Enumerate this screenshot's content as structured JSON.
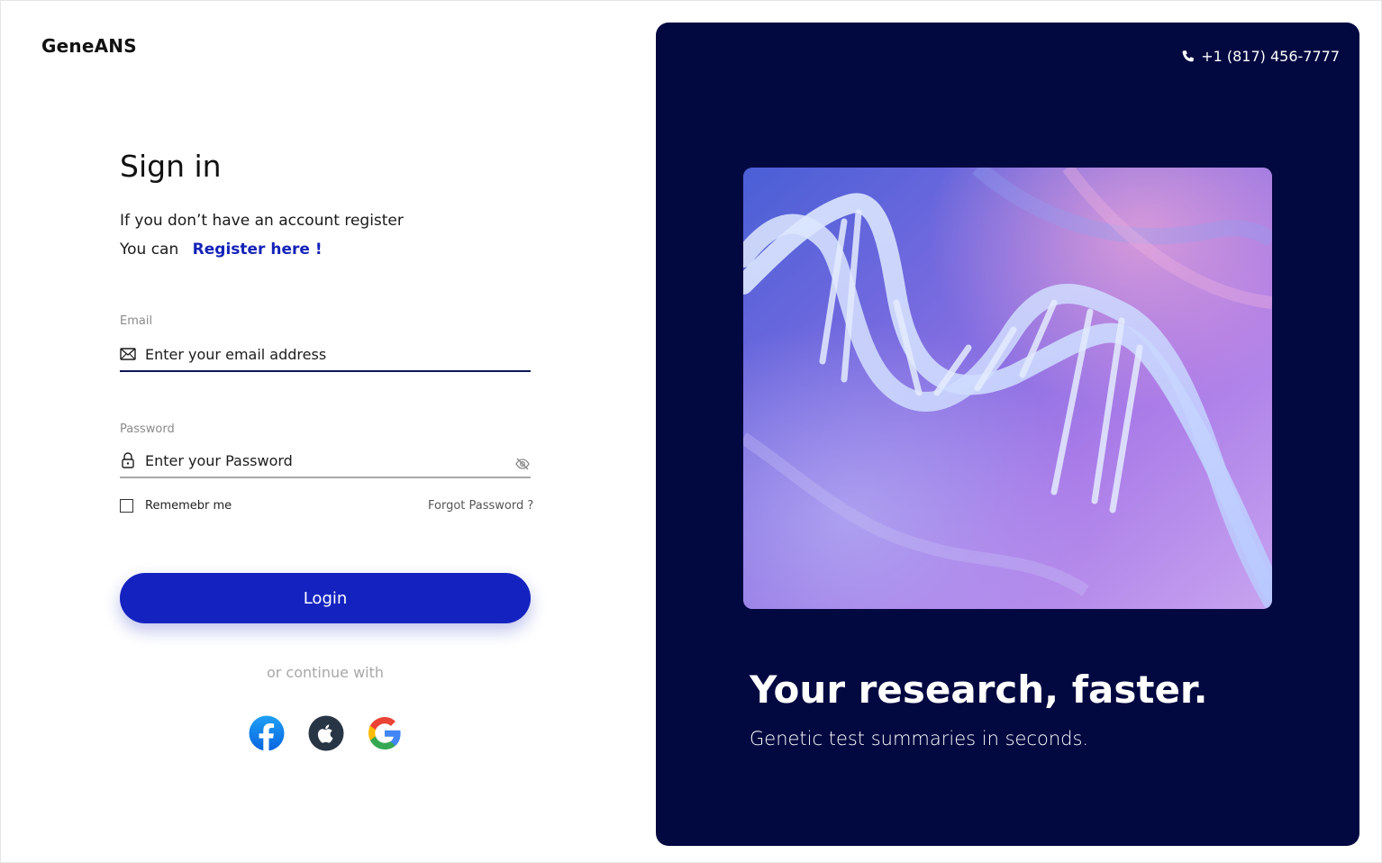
{
  "brand": {
    "name": "GeneANS"
  },
  "signin": {
    "title": "Sign in",
    "register_prompt": "If you don’t have an account register",
    "register_prefix": "You can",
    "register_link": "Register here !"
  },
  "email": {
    "label": "Email",
    "placeholder": "Enter your email address",
    "icon": "mail-icon"
  },
  "password": {
    "label": "Password",
    "placeholder": "Enter your Password",
    "icon": "lock-icon",
    "toggle_icon": "eye-off-icon"
  },
  "remember": {
    "label": "Rememebr me",
    "checked": false
  },
  "forgot": {
    "label": "Forgot Password ?"
  },
  "login": {
    "label": "Login"
  },
  "continue": {
    "label": "or continue with"
  },
  "social": [
    "facebook-icon",
    "apple-icon",
    "google-icon"
  ],
  "right": {
    "phone": "+1 (817) 456-7777",
    "phone_icon": "phone-icon",
    "headline": "Your research, faster.",
    "subheadline": "Genetic test summaries in seconds."
  },
  "colors": {
    "accent": "#1423c0",
    "panel": "#020840",
    "link": "#1423b8"
  }
}
